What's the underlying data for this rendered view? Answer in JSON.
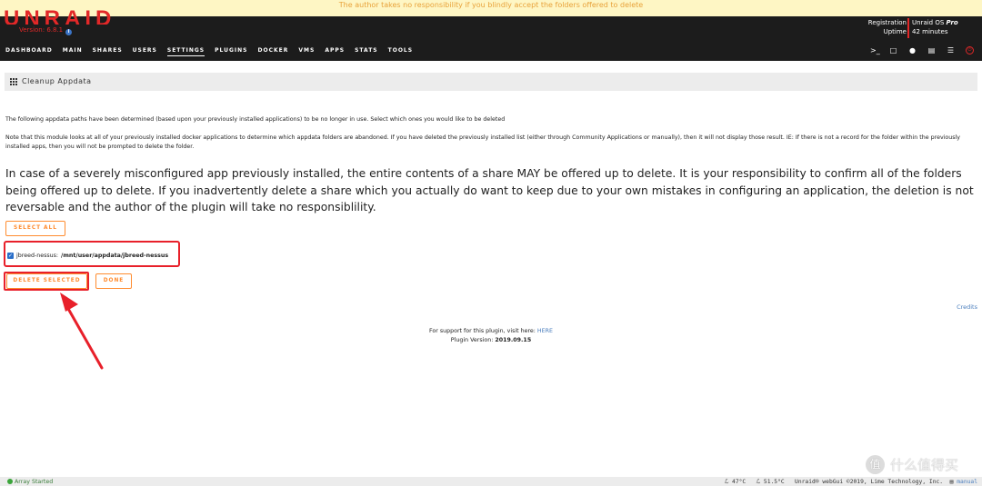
{
  "notice": "The author takes no responsibility if you blindly accept the folders offered to delete",
  "brand": {
    "logo": "UNRAID",
    "version": "Version: 6.8.1"
  },
  "registration": {
    "reg_label": "Registration",
    "uptime_label": "Uptime",
    "os_name": "Unraid OS ",
    "os_edition": "Pro",
    "uptime": "42 minutes"
  },
  "nav": {
    "items": [
      {
        "label": "DASHBOARD"
      },
      {
        "label": "MAIN"
      },
      {
        "label": "SHARES"
      },
      {
        "label": "USERS"
      },
      {
        "label": "SETTINGS"
      },
      {
        "label": "PLUGINS"
      },
      {
        "label": "DOCKER"
      },
      {
        "label": "VMS"
      },
      {
        "label": "APPS"
      },
      {
        "label": "STATS"
      },
      {
        "label": "TOOLS"
      }
    ],
    "active": "SETTINGS",
    "icons": [
      "terminal-icon",
      "feedback-icon",
      "help-icon",
      "display-icon",
      "log-icon",
      "power-icon"
    ]
  },
  "panel": {
    "title": "Cleanup Appdata"
  },
  "content": {
    "intro": "The following appdata paths have been determined (based upon your previously installed applications) to be no longer in use. Select which ones you would like to be deleted",
    "note": "Note that this module looks at all of your previously installed docker applications to determine which appdata folders are abandoned. If you have deleted the previously installed list (either through Community Applications or manually), then it will not display those result. IE: If there is not a record for the folder within the previously installed apps, then you will not be prompted to delete the folder.",
    "warning": "In case of a severely misconfigured app previously installed, the entire contents of a share MAY be offered up to delete. It is your responsibility to confirm all of the folders being offered up to delete. If you inadvertently delete a share which you actually do want to keep due to your own mistakes in configuring an application, the deletion is not reversable and the author of the plugin will take no responsiblility.",
    "select_all": "SELECT ALL",
    "item": {
      "name": "jbreed-nessus:",
      "path": "/mnt/user/appdata/jbreed-nessus",
      "checked": true
    },
    "delete_selected": "DELETE SELECTED",
    "done": "DONE"
  },
  "credits": "Credits",
  "support": {
    "text": "For support for this plugin, visit here: ",
    "link": "HERE",
    "version_label": "Plugin Version: ",
    "version": "2019.09.15"
  },
  "footer": {
    "status": "Array Started",
    "temp1": "ℒ 47°C",
    "temp2": "ℒ 51.5°C",
    "copyright": "Unraid® webGui ©2019, Lime Technology, Inc.",
    "manual": "manual"
  },
  "watermark": {
    "text": "什么值得买",
    "logo": "值"
  },
  "colors": {
    "accent": "#ff8c2f",
    "brand_red": "#e22828",
    "annotation_red": "#e8202a",
    "link": "#4a7ebd"
  }
}
